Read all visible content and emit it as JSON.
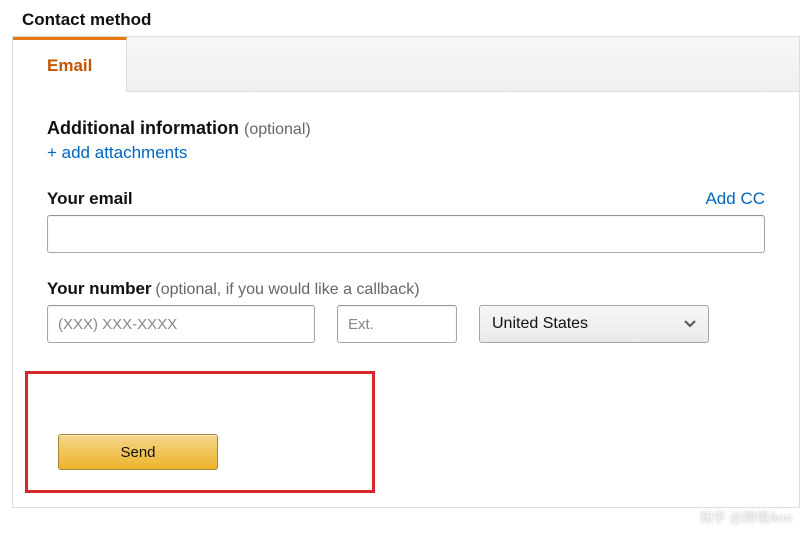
{
  "section_title": "Contact method",
  "tabs": {
    "email": "Email"
  },
  "additional_info": {
    "label_bold": "Additional information",
    "label_optional": "(optional)",
    "add_attachments": "+ add attachments"
  },
  "email_field": {
    "label": "Your email",
    "add_cc": "Add CC",
    "value": ""
  },
  "number_field": {
    "label": "Your number",
    "hint": "(optional, if you would like a callback)",
    "phone_placeholder": "(XXX) XXX-XXXX",
    "ext_placeholder": "Ext.",
    "country_selected": "United States"
  },
  "send_button": "Send",
  "watermark": "知乎 @跨境Ann"
}
